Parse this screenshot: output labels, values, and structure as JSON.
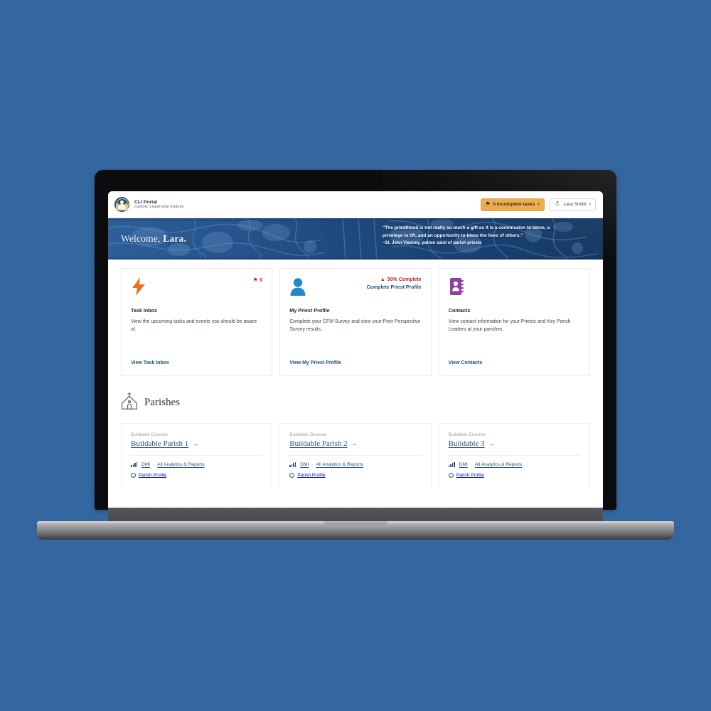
{
  "navbar": {
    "brand_title": "CLI Portal",
    "brand_subtitle": "Catholic Leadership Institute",
    "brand_logo_icon": "cli-globe-logo-icon",
    "tasks_button": {
      "label": "0 incomplete tasks",
      "icon": "flag-icon",
      "caret": "▾",
      "bg_color": "#edaa48"
    },
    "user_menu": {
      "label": "Lara Smith",
      "icon": "person-icon",
      "caret": "▾"
    }
  },
  "hero": {
    "welcome_prefix": "Welcome, ",
    "welcome_name": "Lara.",
    "quote_line_1": "“The priesthood is not really so much a gift as it is a commission to serve, a",
    "quote_line_2": "privelege to lift, and an opportunity to bless the lives of others.”",
    "quote_attribution": "–St. John Vianney, patron saint of parish priests",
    "bg_color": "#1d4478"
  },
  "cards": [
    {
      "icon": "lightning-bolt-icon",
      "icon_color": "#e8721c",
      "badge_icon": "flag-icon",
      "badge_text": "0",
      "title": "Task Inbox",
      "description": "View the upcoming tasks and events you should be aware of.",
      "link_label": "View Task Inbox"
    },
    {
      "icon": "person-avatar-icon",
      "icon_color": "#2089c9",
      "badge_icon": "warning-triangle-icon",
      "badge_text": "50% Complete",
      "badge_link": "Complete Priest Profile",
      "title": "My Priest Profile",
      "description": "Complete your CFM Survey and view your Peer Perspective Survey results.",
      "link_label": "View My Priest Profile"
    },
    {
      "icon": "address-book-icon",
      "icon_color": "#8e3fa0",
      "title": "Contacts",
      "description": "View contact information for your Priests and Key Parish Leaders at your parishes.",
      "link_label": "View Contacts"
    }
  ],
  "parishes": {
    "heading": "Parishes",
    "heading_icon": "church-icon",
    "items": [
      {
        "diocese": "Buildable Diocese",
        "name": "Buildable Parish 1",
        "arrow": "→",
        "dmi_label": "DMI",
        "separator": "·",
        "reports_label": "All Analytics & Reports",
        "profile_label": "Parish Profile"
      },
      {
        "diocese": "Buildable Diocese",
        "name": "Buildable Parish 2",
        "arrow": "→",
        "dmi_label": "DMI",
        "separator": "·",
        "reports_label": "All Analytics & Reports",
        "profile_label": "Parish Profile"
      },
      {
        "diocese": "Buildable Diocese",
        "name": "Buildable 3",
        "arrow": "→",
        "dmi_label": "DMI",
        "separator": "·",
        "reports_label": "All Analytics & Reports",
        "profile_label": "Parish Profile"
      }
    ]
  },
  "colors": {
    "page_background": "#34669f",
    "link_blue": "#1f4e85",
    "alert_red": "#b5282c",
    "accent_orange": "#edaa48"
  }
}
